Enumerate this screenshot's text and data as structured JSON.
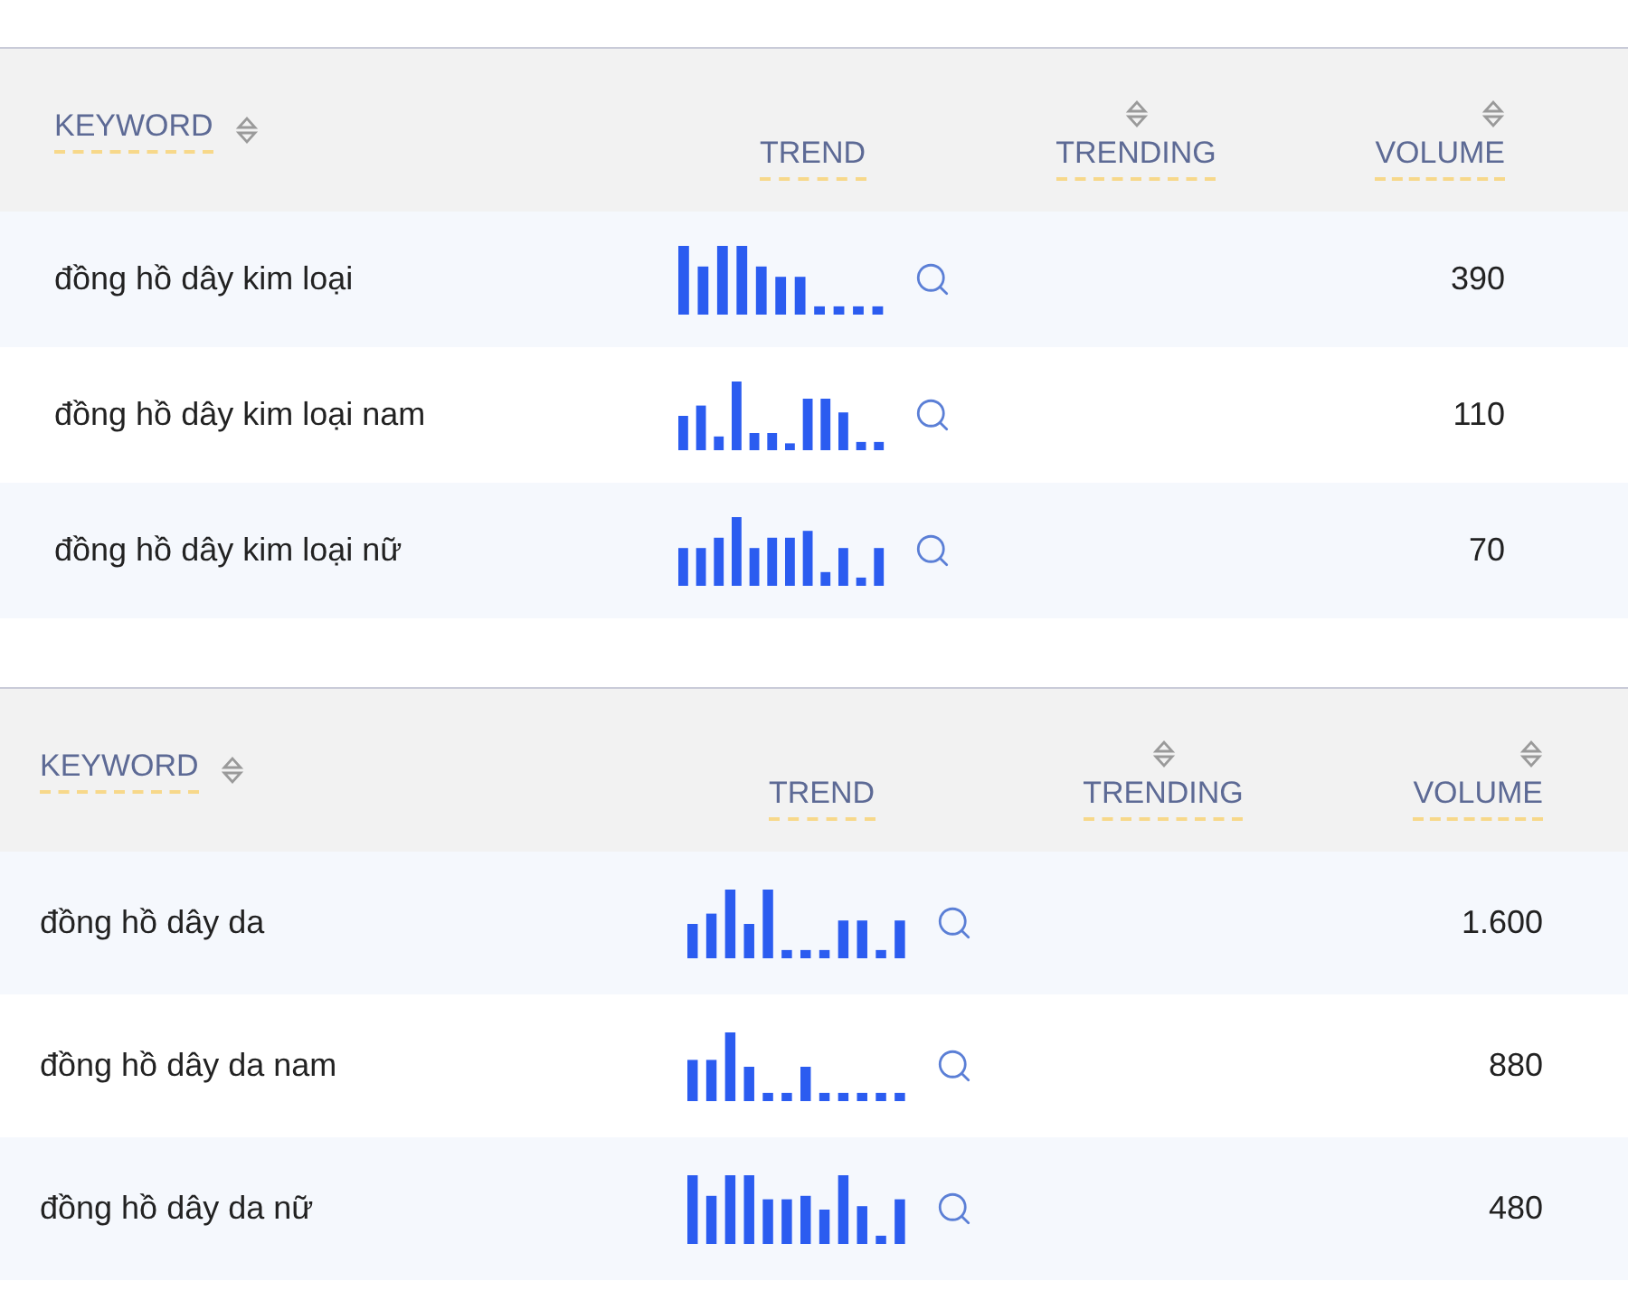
{
  "tables": [
    {
      "columns": [
        {
          "label": "KEYWORD",
          "sortable": true
        },
        {
          "label": "TREND",
          "sortable": false
        },
        {
          "label": "TRENDING",
          "sortable": true
        },
        {
          "label": "VOLUME",
          "sortable": true
        }
      ],
      "rows": [
        {
          "keyword": "đồng hồ dây kim loại",
          "volume": "390"
        },
        {
          "keyword": "đồng hồ dây kim loại nam",
          "volume": "110"
        },
        {
          "keyword": "đồng hồ dây kim loại nữ",
          "volume": "70"
        }
      ]
    },
    {
      "columns": [
        {
          "label": "KEYWORD",
          "sortable": true
        },
        {
          "label": "TREND",
          "sortable": false
        },
        {
          "label": "TRENDING",
          "sortable": true
        },
        {
          "label": "VOLUME",
          "sortable": true
        }
      ],
      "rows": [
        {
          "keyword": "đồng hồ dây da",
          "volume": "1.600"
        },
        {
          "keyword": "đồng hồ dây da nam",
          "volume": "880"
        },
        {
          "keyword": "đồng hồ dây da nữ",
          "volume": "480"
        }
      ]
    }
  ]
}
